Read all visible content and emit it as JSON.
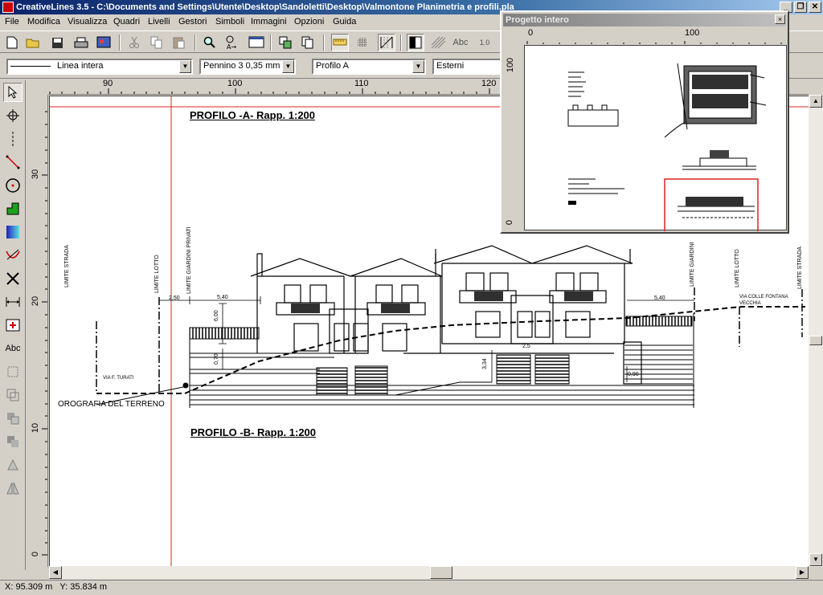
{
  "window": {
    "title": "CreativeLines 3.5  - C:\\Documents and Settings\\Utente\\Desktop\\Sandoletti\\Desktop\\Valmontone Planimetria e profili.pla",
    "min_label": "_",
    "restore_label": "❐",
    "close_label": "✕"
  },
  "menu": [
    "File",
    "Modifica",
    "Visualizza",
    "Quadri",
    "Livelli",
    "Gestori",
    "Simboli",
    "Immagini",
    "Opzioni",
    "Guida"
  ],
  "toolbar": {
    "text_tool_label": "Abc",
    "angle_tool_label": "1.0"
  },
  "properties": {
    "line_type": "Linea intera",
    "pen": "Pennino 3   0,35 mm",
    "level": "Profilo A",
    "group": "Esterni"
  },
  "tools": {
    "text_label": "Abc"
  },
  "hruler": {
    "labels": [
      "90",
      "100",
      "110",
      "120"
    ]
  },
  "vruler": {
    "labels": [
      "30",
      "20",
      "10",
      "0"
    ]
  },
  "drawing": {
    "title_a": "PROFILO -A- Rapp. 1:200",
    "title_b": "PROFILO -B- Rapp. 1:200",
    "terrain_label": "OROGRAFIA DEL TERRENO",
    "limite_strada": "LIMITE STRADA",
    "limite_lotto": "LIMITE LOTTO",
    "limite_giardini_privati": "LIMITE GIARDINI PRIVATI",
    "limite_giardini": "LIMITE GIARDINI",
    "via_turati": "VIA F. TURATI",
    "via_colle_line1": "VIA COLLE FONTANA",
    "via_colle_line2": "VECCHIA",
    "dim_540_left": "5,40",
    "dim_540_right": "5,40",
    "dim_250": "2,50",
    "dim_600": "6,00",
    "dim_070": "0,70",
    "dim_334": "3,34",
    "dim_090": "0,90",
    "dim_25": "2,5"
  },
  "overview": {
    "title": "Progetto intero",
    "close": "×",
    "x_labels": [
      "0",
      "100"
    ],
    "y_labels": [
      "100",
      "0"
    ]
  },
  "status": {
    "x": "X: 95.309 m",
    "y": "Y: 35.834 m"
  }
}
